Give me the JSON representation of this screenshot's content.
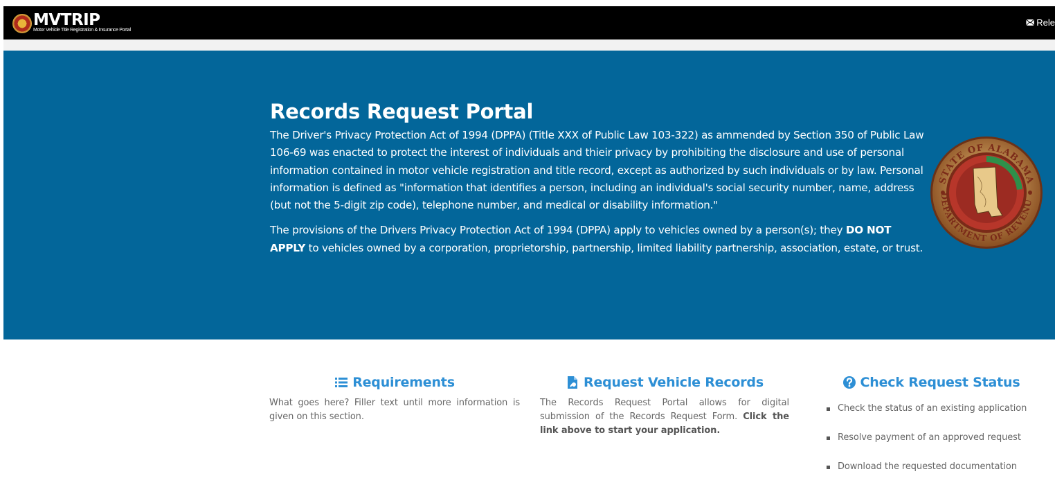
{
  "navbar": {
    "brand_title": "MVTRIP",
    "brand_subtitle": "Motor Vehicle Title Registration & Insurance Portal",
    "right_link_label": "Rele",
    "right_link_icon": "envelope-icon"
  },
  "hero": {
    "title": "Records Request Portal",
    "paragraph1": "The Driver's Privacy Protection Act of 1994 (DPPA) (Title XXX of Public Law 103-322) as ammended by Section 350 of Public Law 106-69 was enacted to protect the interest of individuals and thieir privacy by prohibiting the disclosure and use of personal information contained in motor vehicle registration and title record, except as authorized by such individuals or by law. Personal information is defined as \"information that identifies a person, including an individual's social security number, name, address (but not the 5-digit zip code), telephone number, and medical or disability information.\"",
    "paragraph2_before": "The provisions of the Drivers Privacy Protection Act of 1994 (DPPA) apply to vehicles owned by a person(s); they ",
    "paragraph2_bold": "DO NOT APPLY",
    "paragraph2_after": " to vehicles owned by a corporation, proprietorship, partnership, limited liability partnership, association, estate, or trust.",
    "seal_text_top": "STATE OF ALABAMA",
    "seal_text_bottom": "DEPARTMENT OF REVENUE"
  },
  "columns": {
    "requirements": {
      "icon": "list-icon",
      "title": "Requirements",
      "text": "What goes here? Filler text until more information is given on this section."
    },
    "request_records": {
      "icon": "file-request-icon",
      "title": "Request Vehicle Records",
      "text_before": "The Records Request Portal allows for digital submission of the Records Request Form. ",
      "text_bold": "Click the link above to start your application."
    },
    "check_status": {
      "icon": "question-circle-icon",
      "title": "Check Request Status",
      "items": [
        "Check the status of an existing application",
        "Resolve payment of an approved request",
        "Download the requested documentation"
      ]
    }
  },
  "colors": {
    "navbar": "#000000",
    "hero_background": "#03669a",
    "link_blue": "#2d8fd5",
    "body_text": "#666666"
  }
}
